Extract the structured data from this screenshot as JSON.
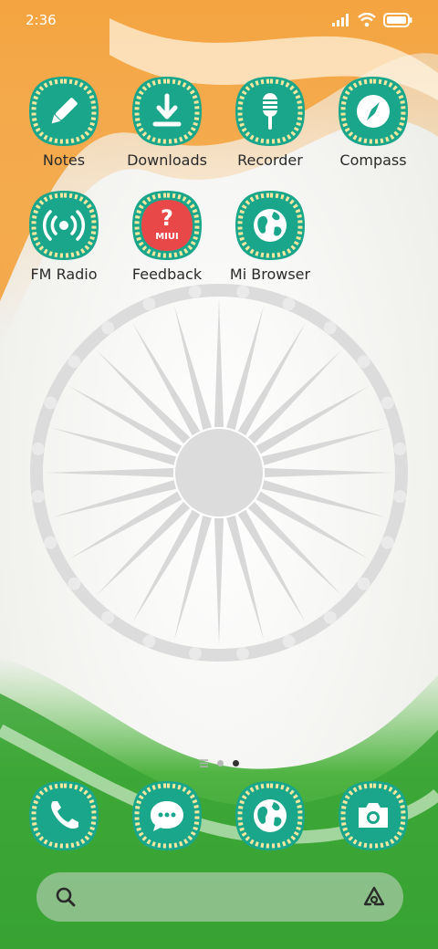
{
  "status_bar": {
    "time": "2:36"
  },
  "home_rows": [
    [
      {
        "label": "Notes",
        "icon": "pencil-icon"
      },
      {
        "label": "Downloads",
        "icon": "download-icon"
      },
      {
        "label": "Recorder",
        "icon": "microphone-icon"
      },
      {
        "label": "Compass",
        "icon": "compass-icon"
      }
    ],
    [
      {
        "label": "FM Radio",
        "icon": "radio-icon"
      },
      {
        "label": "Feedback",
        "icon": "feedback-icon",
        "badge": "MIUI"
      },
      {
        "label": "Mi Browser",
        "icon": "globe-icon"
      }
    ]
  ],
  "page_indicator": {
    "pages": 2,
    "active": 2
  },
  "dock": [
    {
      "name": "phone",
      "icon": "phone-icon"
    },
    {
      "name": "messages",
      "icon": "message-icon"
    },
    {
      "name": "browser",
      "icon": "globe-icon"
    },
    {
      "name": "camera",
      "icon": "camera-icon"
    }
  ],
  "search": {
    "icon": "search-icon",
    "assistant_icon": "assistant-icon"
  },
  "colors": {
    "icon_green": "#1aa68a",
    "icon_ring": "#f5e7a0",
    "saffron": "#f19a2a",
    "green": "#3aa838",
    "chakra": "#d8d8d8"
  }
}
